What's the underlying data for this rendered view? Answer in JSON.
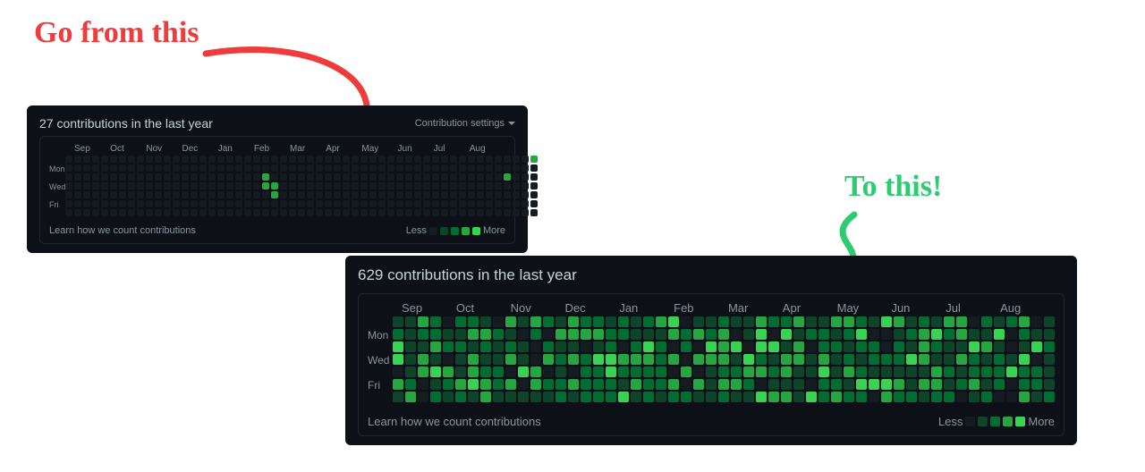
{
  "annotations": {
    "from_text": "Go from this",
    "to_text": "To this!"
  },
  "months": [
    "Sep",
    "Oct",
    "Nov",
    "Dec",
    "Jan",
    "Feb",
    "Mar",
    "Apr",
    "May",
    "Jun",
    "Jul",
    "Aug"
  ],
  "day_labels_visible": [
    "Mon",
    "Wed",
    "Fri"
  ],
  "legend": {
    "less": "Less",
    "more": "More"
  },
  "footer_link": "Learn how we count contributions",
  "card_small": {
    "title": "27 contributions in the last year",
    "settings_label": "Contribution settings",
    "weeks": 53,
    "seed": 27
  },
  "card_big": {
    "title": "629 contributions in the last year",
    "weeks": 53,
    "seed": 629
  },
  "colors": {
    "levels": [
      "#161b22",
      "#0e4429",
      "#006d32",
      "#26a641",
      "#39d353"
    ],
    "red": "#ee3b3b",
    "green": "#2ecc71"
  },
  "chart_data": {
    "type": "heatmap",
    "description": "GitHub-style contribution calendar heatmaps (one sparse, one dense)",
    "x_axis": "week of year (Sep→Aug, 53 weeks)",
    "y_axis": "day of week (Sun→Sat, 7 rows; Mon/Wed/Fri labeled)",
    "value_scale": {
      "min": 0,
      "max": 4,
      "meaning": "0=no contributions, 4=many"
    },
    "panels": [
      {
        "name": "before",
        "total_contributions": 27,
        "nonzero_cells": [
          {
            "week": 22,
            "day": 2,
            "level": 3
          },
          {
            "week": 22,
            "day": 3,
            "level": 3
          },
          {
            "week": 23,
            "day": 3,
            "level": 3
          },
          {
            "week": 23,
            "day": 4,
            "level": 3
          },
          {
            "week": 49,
            "day": 2,
            "level": 3
          },
          {
            "week": 52,
            "day": 0,
            "level": 3
          }
        ]
      },
      {
        "name": "after",
        "total_contributions": 629,
        "density": "high — most days level 1-3; generated pseudo-randomly below with seed 629 to match visual density",
        "approx_level_distribution": {
          "0": 0.1,
          "1": 0.3,
          "2": 0.3,
          "3": 0.22,
          "4": 0.08
        }
      }
    ]
  }
}
